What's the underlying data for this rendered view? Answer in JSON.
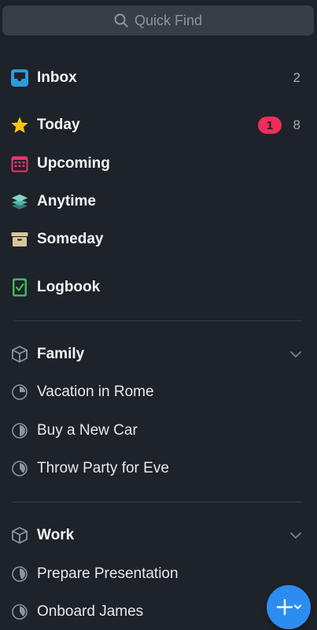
{
  "search": {
    "label": "Quick Find"
  },
  "lists": [
    {
      "label": "Inbox",
      "count": "2",
      "icon": "inbox-icon",
      "color": "#2d9cdb"
    },
    {
      "label": "Today",
      "badge": "1",
      "count": "8",
      "icon": "star-icon",
      "color": "#f5c518"
    },
    {
      "label": "Upcoming",
      "icon": "calendar-icon",
      "color": "#e8336d"
    },
    {
      "label": "Anytime",
      "icon": "layers-icon",
      "color": "#4fb3a9"
    },
    {
      "label": "Someday",
      "icon": "archive-box-icon",
      "color": "#d6c79a"
    },
    {
      "label": "Logbook",
      "icon": "logbook-check-icon",
      "color": "#3cba54"
    }
  ],
  "areas": [
    {
      "label": "Family",
      "icon": "area-cube-icon",
      "projects": [
        {
          "label": "Vacation in Rome",
          "icon": "progress-pie-icon",
          "progress": 0.25
        },
        {
          "label": "Buy a New Car",
          "icon": "progress-pie-icon",
          "progress": 0.5
        },
        {
          "label": "Throw Party for Eve",
          "icon": "progress-pie-icon",
          "progress": 0.4
        }
      ]
    },
    {
      "label": "Work",
      "icon": "area-cube-icon",
      "projects": [
        {
          "label": "Prepare Presentation",
          "icon": "progress-pie-icon",
          "progress": 0.45
        },
        {
          "label": "Onboard James",
          "icon": "progress-pie-icon",
          "progress": 0.4
        }
      ]
    }
  ],
  "fab": {
    "icon": "add-plus-chevron-icon",
    "color": "#2d8cf0"
  },
  "colors": {
    "background": "#1e2229",
    "search_bg": "#383d46",
    "badge": "#ee2d5a"
  }
}
